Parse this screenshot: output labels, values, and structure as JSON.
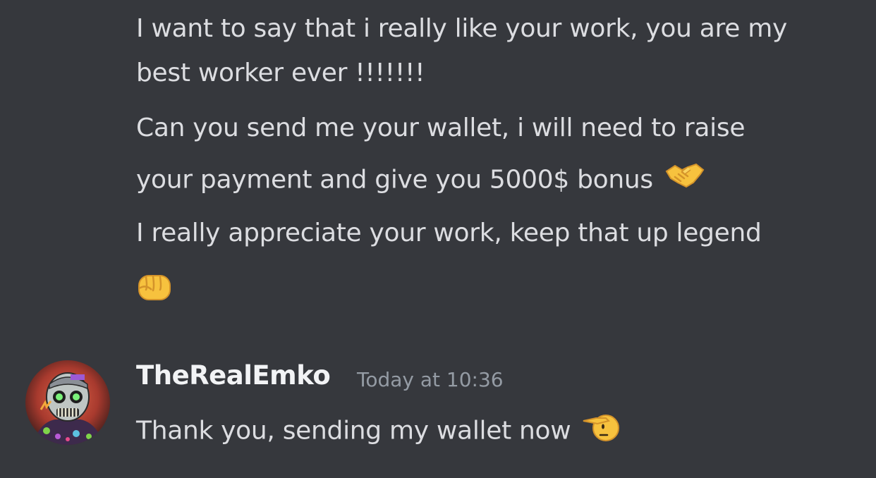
{
  "messages_prev": {
    "line1": "I want to say that i really like your work, you are my",
    "line2": "best worker ever !!!!!!!",
    "line3": "Can you send me your wallet, i will need to raise",
    "line4": "your payment and give you 5000$ bonus",
    "line5": "I really appreciate your work, keep that up legend",
    "emoji_handshake": "handshake-emoji",
    "emoji_fist": "oncoming-fist-emoji"
  },
  "reply": {
    "username": "TheRealEmko",
    "timestamp": "Today at 10:36",
    "text": "Thank you, sending my wallet now",
    "emoji": "saluting-face-emoji",
    "avatar": "zombie-avatar"
  },
  "colors": {
    "background": "#36383d",
    "text": "#dcdde1",
    "username": "#f2f3f5",
    "timestamp": "#949ba4"
  }
}
